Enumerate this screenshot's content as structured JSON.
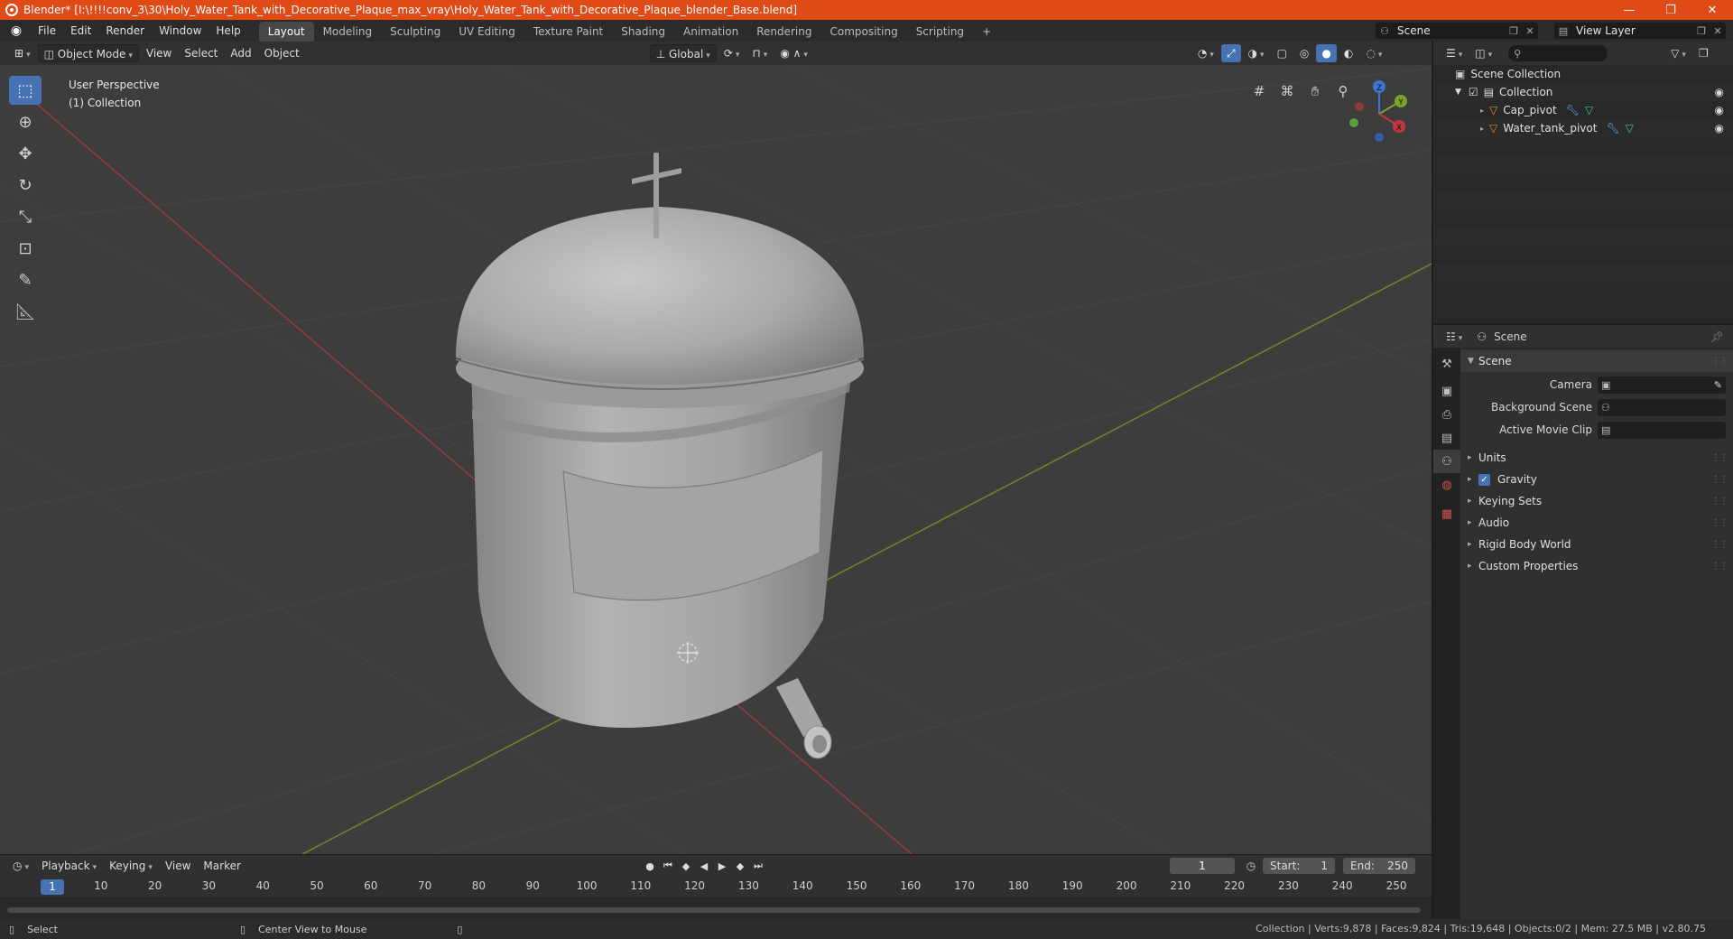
{
  "window": {
    "title": "Blender* [I:\\!!!!conv_3\\30\\Holy_Water_Tank_with_Decorative_Plaque_max_vray\\Holy_Water_Tank_with_Decorative_Plaque_blender_Base.blend]",
    "minimize": "—",
    "maximize": "❐",
    "close": "✕"
  },
  "menu": {
    "items": [
      "File",
      "Edit",
      "Render",
      "Window",
      "Help"
    ],
    "workspaces": [
      "Layout",
      "Modeling",
      "Sculpting",
      "UV Editing",
      "Texture Paint",
      "Shading",
      "Animation",
      "Rendering",
      "Compositing",
      "Scripting"
    ],
    "add_workspace": "+",
    "scene": "Scene",
    "view_layer": "View Layer"
  },
  "viewport": {
    "mode": "Object Mode",
    "menus": [
      "View",
      "Select",
      "Add",
      "Object"
    ],
    "transform_orientation": "Global",
    "info_line1": "User Perspective",
    "info_line2": "(1) Collection",
    "gizmo": {
      "x": "X",
      "y": "Y",
      "z": "Z"
    }
  },
  "timeline": {
    "menus": [
      "Playback",
      "Keying",
      "View",
      "Marker"
    ],
    "current_frame": "1",
    "start_label": "Start:",
    "start": "1",
    "end_label": "End:",
    "end": "250",
    "ticks": [
      "10",
      "20",
      "30",
      "40",
      "50",
      "60",
      "70",
      "80",
      "90",
      "100",
      "110",
      "120",
      "130",
      "140",
      "150",
      "160",
      "170",
      "180",
      "190",
      "200",
      "210",
      "220",
      "230",
      "240",
      "250"
    ]
  },
  "statusbar": {
    "select": "Select",
    "center_view": "Center View to Mouse",
    "stats": "Collection | Verts:9,878 | Faces:9,824 | Tris:19,648 | Objects:0/2 | Mem: 27.5 MB | v2.80.75"
  },
  "outliner": {
    "scene_collection": "Scene Collection",
    "collection": "Collection",
    "objects": [
      "Cap_pivot",
      "Water_tank_pivot"
    ]
  },
  "properties": {
    "context": "Scene",
    "panel": "Scene",
    "camera_label": "Camera",
    "background_scene_label": "Background Scene",
    "active_movie_clip_label": "Active Movie Clip",
    "sections": [
      "Units",
      "Gravity",
      "Keying Sets",
      "Audio",
      "Rigid Body World",
      "Custom Properties"
    ]
  },
  "colors": {
    "titlebar": "#e04a16",
    "accent": "#4772b3",
    "viewport_bg": "#3d3d3d",
    "x_axis": "#c4363f",
    "y_axis": "#7ea32a",
    "z_axis": "#3b78d6"
  }
}
